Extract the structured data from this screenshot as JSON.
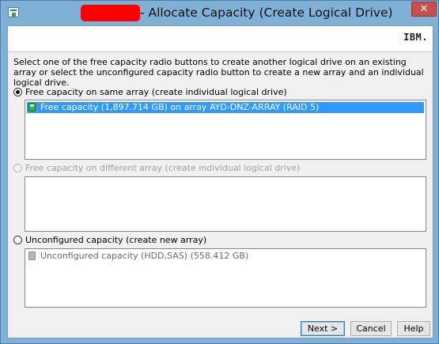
{
  "window": {
    "title": "- Allocate Capacity (Create Logical Drive)",
    "close_symbol": "✕"
  },
  "header": {
    "logo_text": "IBM."
  },
  "instructions": "Select one of the free capacity radio buttons to create another logical drive on an existing array or select the unconfigured capacity radio button to create a new array and an individual logical drive.",
  "options": [
    {
      "label": "Free capacity on same array (create individual logical drive)",
      "selected": true,
      "enabled": true,
      "items": [
        {
          "text": "Free capacity (1,897.714 GB) on array AYD-DNZ-ARRAY (RAID 5)",
          "icon": "green-drive-icon",
          "selected": true
        }
      ]
    },
    {
      "label": "Free capacity on different array (create individual logical drive)",
      "selected": false,
      "enabled": false,
      "items": []
    },
    {
      "label": "Unconfigured capacity (create new array)",
      "selected": false,
      "enabled": true,
      "items": [
        {
          "text": "Unconfigured capacity (HDD,SAS) (558.412 GB)",
          "icon": "grey-drive-icon",
          "selected": false
        }
      ]
    }
  ],
  "buttons": {
    "next": "Next >",
    "cancel": "Cancel",
    "help": "Help"
  },
  "colors": {
    "selection": "#3399ff",
    "redaction": "#ff0000",
    "close": "#c7504b"
  }
}
